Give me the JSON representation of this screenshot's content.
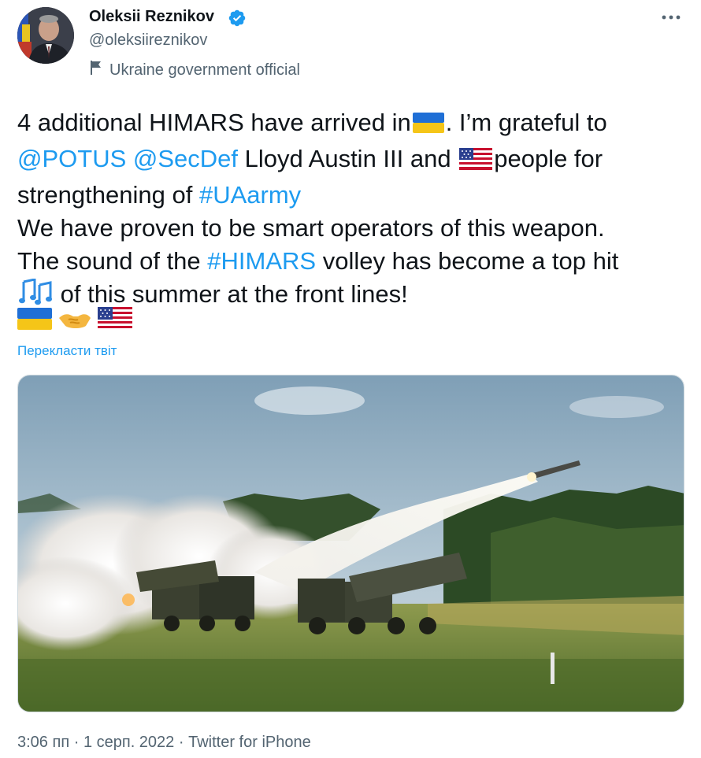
{
  "author": {
    "name": "Oleksii Reznikov",
    "handle": "@oleksiireznikov",
    "label": "Ukraine government official"
  },
  "icons": {
    "verified": "verified-badge-icon",
    "more": "more-options-icon",
    "government_label": "flag-icon"
  },
  "colors": {
    "link": "#1d9bf0",
    "secondary_text": "#536471",
    "text": "#0f1419"
  },
  "tweet": {
    "line1_a": "4 additional HIMARS have arrived in",
    "line1_b": ". I’m grateful to",
    "mention_potus": "@POTUS",
    "mention_secdef": "@SecDef",
    "line2_mid": " Lloyd Austin III and ",
    "line2_end": "people for",
    "line3_a": "strengthening of ",
    "hashtag_uaarmy": "#UAarmy",
    "line4": "We have proven to be smart operators of this weapon.",
    "line5_a": "The sound of the ",
    "hashtag_himars": "#HIMARS",
    "line5_b": " volley has become a top hit",
    "line6": " of this summer at the front lines!",
    "emoji": [
      "ukraine-flag",
      "handshake",
      "usa-flag"
    ]
  },
  "translate": "Перекласти твіт",
  "media": {
    "description": "HIMARS launcher firing a rocket in a field"
  },
  "footer": {
    "time": "3:06 пп",
    "date": "1 серп. 2022",
    "source": "Twitter for iPhone",
    "separator": " · "
  }
}
